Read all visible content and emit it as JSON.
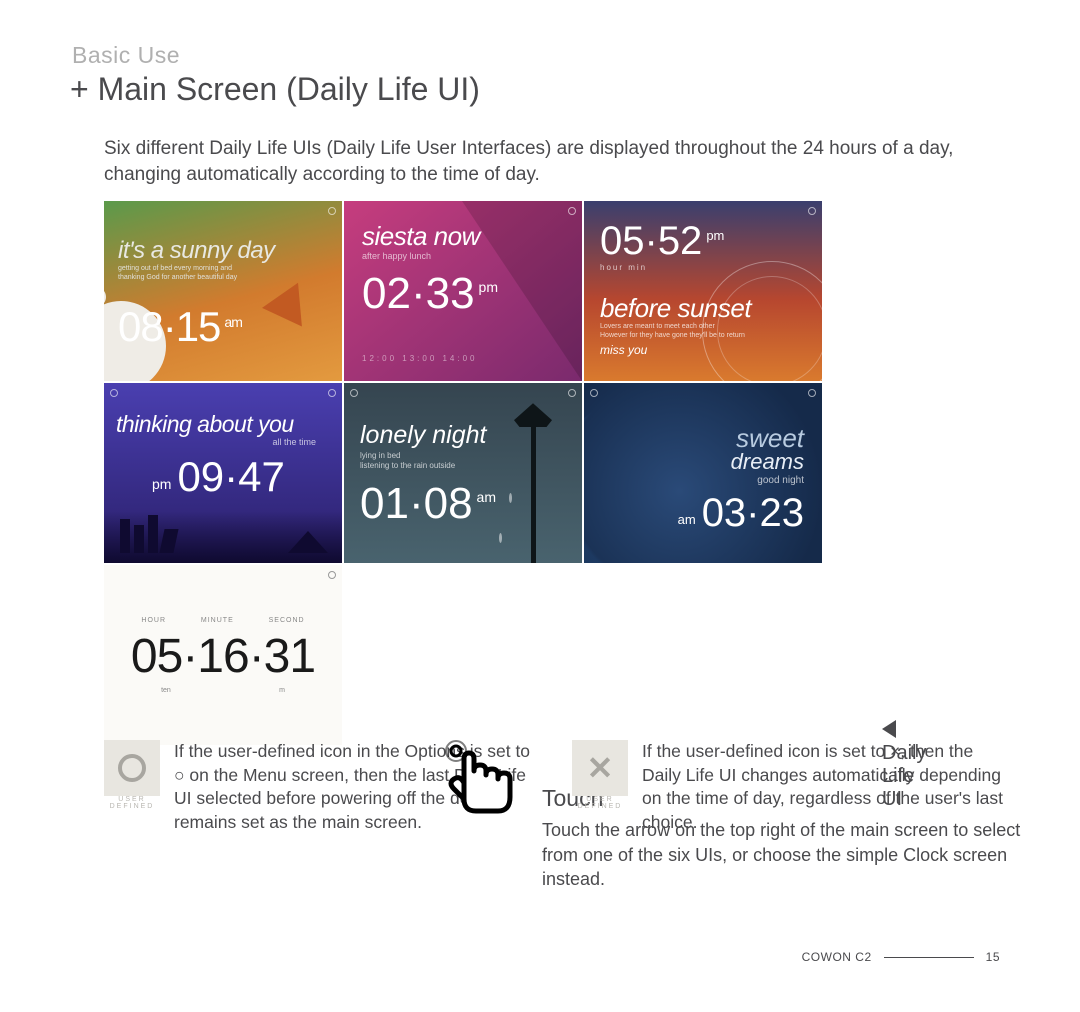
{
  "overline": "Basic Use",
  "title": "+ Main Screen (Daily Life UI)",
  "intro": "Six different Daily Life UIs (Daily Life User Interfaces) are displayed throughout the 24 hours of a day, changing automatically according to the time of day.",
  "tiles": {
    "sunny": {
      "head": "it's a sunny day",
      "sub1": "getting out of bed every morning and",
      "sub2": "thanking God for another beautiful day",
      "time": "08·15",
      "ampm": "am"
    },
    "siesta": {
      "head": "siesta now",
      "sub": "after happy lunch",
      "time": "02·33",
      "ampm": "pm",
      "ticks": "12:00  13:00  14:00"
    },
    "sunset": {
      "time": "05·52",
      "ampm": "pm",
      "lbl": "hour        min",
      "head": "before sunset",
      "sub1": "Lovers are meant to meet each other",
      "sub2": "However for they have gone they'll be to return",
      "miss": "miss you"
    },
    "thinking": {
      "head": "thinking about you",
      "sub": "all the time",
      "ampm": "pm",
      "time": "09·47"
    },
    "lonely": {
      "head": "lonely night",
      "sub1": "lying in bed",
      "sub2": "listening to the rain outside",
      "time": "01·08",
      "ampm": "am"
    },
    "dreams": {
      "head": "sweet",
      "head2": "dreams",
      "sub": "good night",
      "ampm": "am",
      "time": "03·23"
    },
    "clock": {
      "l1": "HOUR",
      "l2": "MINUTE",
      "l3": "SECOND",
      "time": "05·16·31",
      "s1": "ten",
      "s2": "m"
    }
  },
  "label_right": "Daily Life UI",
  "touch": {
    "h": "Touch",
    "p": "Touch the arrow on the top right of the main screen to select from one of the six UIs, or choose the simple Clock screen instead."
  },
  "notes": {
    "ud": "USER DEFINED",
    "circle": "If the user-defined icon in the Options is set to ○ on the Menu screen, then the last Daily Life UI selected before powering off the device remains set as the main screen.",
    "x": "If the user-defined icon is set to ×, then the Daily Life UI changes automatically depending on the time of day, regardless of the user's last choice."
  },
  "footer": {
    "product": "COWON C2",
    "page": "15"
  }
}
